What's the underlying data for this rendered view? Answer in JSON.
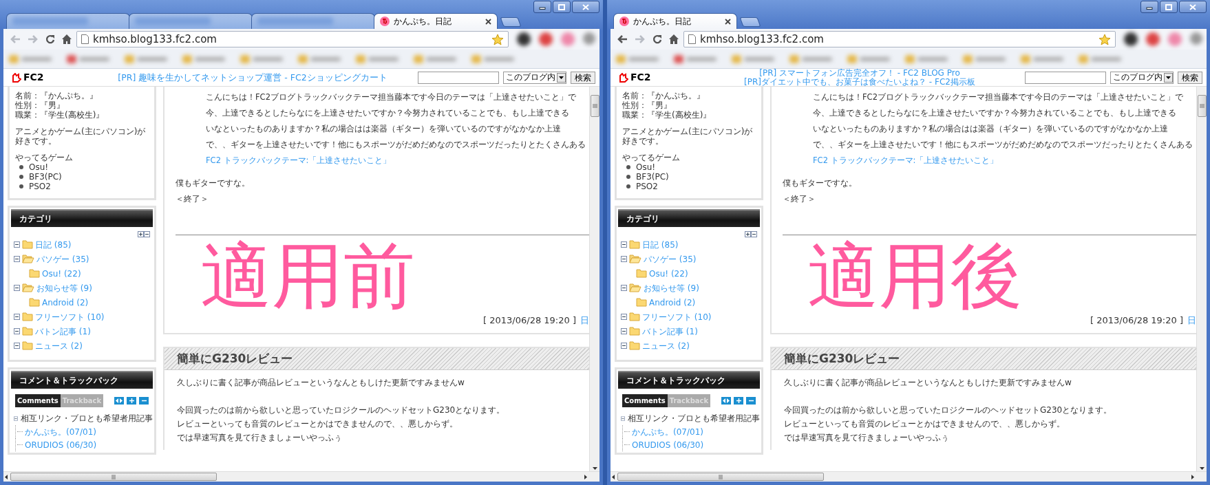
{
  "windows": [
    {
      "tabs": [
        {
          "kind": "blurred",
          "selected": false
        },
        {
          "kind": "blurred",
          "selected": false
        },
        {
          "kind": "blurred",
          "selected": false
        },
        {
          "kind": "page",
          "label": "かんぷち。日記",
          "selected": true
        }
      ],
      "navigation": {
        "back": {
          "disabled": true
        },
        "forward": {
          "disabled": true
        }
      },
      "address": {
        "url": "kmhso.blog133.fc2.com"
      },
      "header": {
        "logo": "FC2",
        "pr_links": [
          "[PR] 趣味を生かしてネットショップ運営 - FC2ショッピングカート"
        ],
        "search": {
          "scope": "このブログ内",
          "button": "検索"
        }
      },
      "profile": {
        "lines": [
          "名前：『かんぷち。』",
          "性別：『男』",
          "職業：『学生(高校生)』"
        ],
        "intro": "アニメとかゲーム(主にパソコン)が好きです。",
        "games_heading": "やってるゲーム",
        "games": [
          "Osu!",
          "BF3(PC)",
          "PSO2"
        ]
      },
      "categories": {
        "title": "カテゴリ",
        "items": [
          {
            "label": "日記 (85)",
            "expanded": false
          },
          {
            "label": "パソゲー (35)",
            "expanded": true,
            "children": [
              {
                "label": "Osu! (22)",
                "expanded": false
              }
            ]
          },
          {
            "label": "お知らせ等 (9)",
            "expanded": true,
            "children": [
              {
                "label": "Android (2)",
                "expanded": false
              }
            ]
          },
          {
            "label": "フリーソフト (10)",
            "expanded": false
          },
          {
            "label": "バトン記事 (1)",
            "expanded": false
          },
          {
            "label": "ニュース (2)",
            "expanded": false
          }
        ]
      },
      "comments": {
        "title": "コメント＆トラックバック",
        "tabs": [
          {
            "label": "Comments",
            "selected": true
          },
          {
            "label": "Trackback",
            "selected": false
          }
        ],
        "tree": [
          {
            "label": "相互リンク・ブロとも希望者用記事",
            "children": [
              {
                "label": "かんぷち。(07/01)"
              },
              {
                "label": "ORUDIOS (06/30)"
              }
            ]
          }
        ]
      },
      "post": {
        "quote_lines": [
          "こんにちは！FC2ブログトラックバックテーマ担当藤本です今日のテーマは「上達させたいこと」で",
          "今、上達できるとしたらなにを上達させたいですか？今努力されていることでも、もし上達できる",
          "いなといったものありますか？私の場合はは楽器（ギター）を弾いているのですがなかなか上達",
          "で、、ギターを上達させたいです！他にもスポーツがだめだめなのでスポーツだったりとたくさんある"
        ],
        "theme_link": "FC2 トラックバックテーマ:「上達させたいこと」",
        "body_lines": [
          "僕もギターですな。",
          "＜終了＞"
        ],
        "stamp": "適用前",
        "date": "[ 2013/06/28 19:20 ]",
        "category_link": "日"
      },
      "next_post": {
        "title": "簡単にG230レビュー",
        "paragraphs": [
          [
            "久しぶりに書く記事が商品レビューというなんともしけた更新ですみませんw"
          ],
          [
            "今回買ったのは前から欲しいと思っていたロジクールのヘッドセットG230となります。",
            "レビューといっても音質のレビューとかはできませんので、、悪しからず。",
            "では早速写真を見て行きましょーいやっふぅ"
          ]
        ]
      }
    },
    {
      "tabs": [
        {
          "kind": "page",
          "label": "かんぷち。日記",
          "selected": true
        }
      ],
      "navigation": {
        "back": {
          "disabled": false
        },
        "forward": {
          "disabled": true
        }
      },
      "address": {
        "url": "kmhso.blog133.fc2.com"
      },
      "header": {
        "logo": "FC2",
        "pr_links": [
          "[PR] スマートフォン広告完全オフ！ - FC2 BLOG Pro",
          "[PR]ダイエット中でも、お菓子は食べたいよね？ - FC2掲示板"
        ],
        "search": {
          "scope": "このブログ内",
          "button": "検索"
        }
      },
      "profile": {
        "lines": [
          "名前：『かんぷち。』",
          "性別：『男』",
          "職業：『学生(高校生)』"
        ],
        "intro": "アニメとかゲーム(主にパソコン)が好きです。",
        "games_heading": "やってるゲーム",
        "games": [
          "Osu!",
          "BF3(PC)",
          "PSO2"
        ]
      },
      "categories": {
        "title": "カテゴリ",
        "items": [
          {
            "label": "日記 (85)",
            "expanded": false
          },
          {
            "label": "パソゲー (35)",
            "expanded": true,
            "children": [
              {
                "label": "Osu! (22)",
                "expanded": false
              }
            ]
          },
          {
            "label": "お知らせ等 (9)",
            "expanded": true,
            "children": [
              {
                "label": "Android (2)",
                "expanded": false
              }
            ]
          },
          {
            "label": "フリーソフト (10)",
            "expanded": false
          },
          {
            "label": "バトン記事 (1)",
            "expanded": false
          },
          {
            "label": "ニュース (2)",
            "expanded": false
          }
        ]
      },
      "comments": {
        "title": "コメント＆トラックバック",
        "tabs": [
          {
            "label": "Comments",
            "selected": true
          },
          {
            "label": "Trackback",
            "selected": false
          }
        ],
        "tree": [
          {
            "label": "相互リンク・ブロとも希望者用記事",
            "children": [
              {
                "label": "かんぷち。(07/01)"
              },
              {
                "label": "ORUDIOS (06/30)"
              }
            ]
          }
        ]
      },
      "post": {
        "quote_lines": [
          "こんにちは！FC2ブログトラックバックテーマ担当藤本です今日のテーマは「上達させたいこと」で",
          "今、上達できるとしたらなにを上達させたいですか？今努力されていることでも、もし上達できる",
          "いなといったものありますか？私の場合はは楽器（ギター）を弾いているのですがなかなか上達",
          "で、、ギターを上達させたいです！他にもスポーツがだめだめなのでスポーツだったりとたくさんある"
        ],
        "theme_link": "FC2 トラックバックテーマ:「上達させたいこと」",
        "body_lines": [
          "僕もギターですな。",
          "＜終了＞"
        ],
        "stamp": "適用後",
        "date": "[ 2013/06/28 19:20 ]",
        "category_link": "日"
      },
      "next_post": {
        "title": "簡単にG230レビュー",
        "paragraphs": [
          [
            "久しぶりに書く記事が商品レビューというなんともしけた更新ですみませんw"
          ],
          [
            "今回買ったのは前から欲しいと思っていたロジクールのヘッドセットG230となります。",
            "レビューといっても音質のレビューとかはできませんので、、悪しからず。",
            "では早速写真を見て行きましょーいやっふぅ"
          ]
        ]
      }
    }
  ]
}
